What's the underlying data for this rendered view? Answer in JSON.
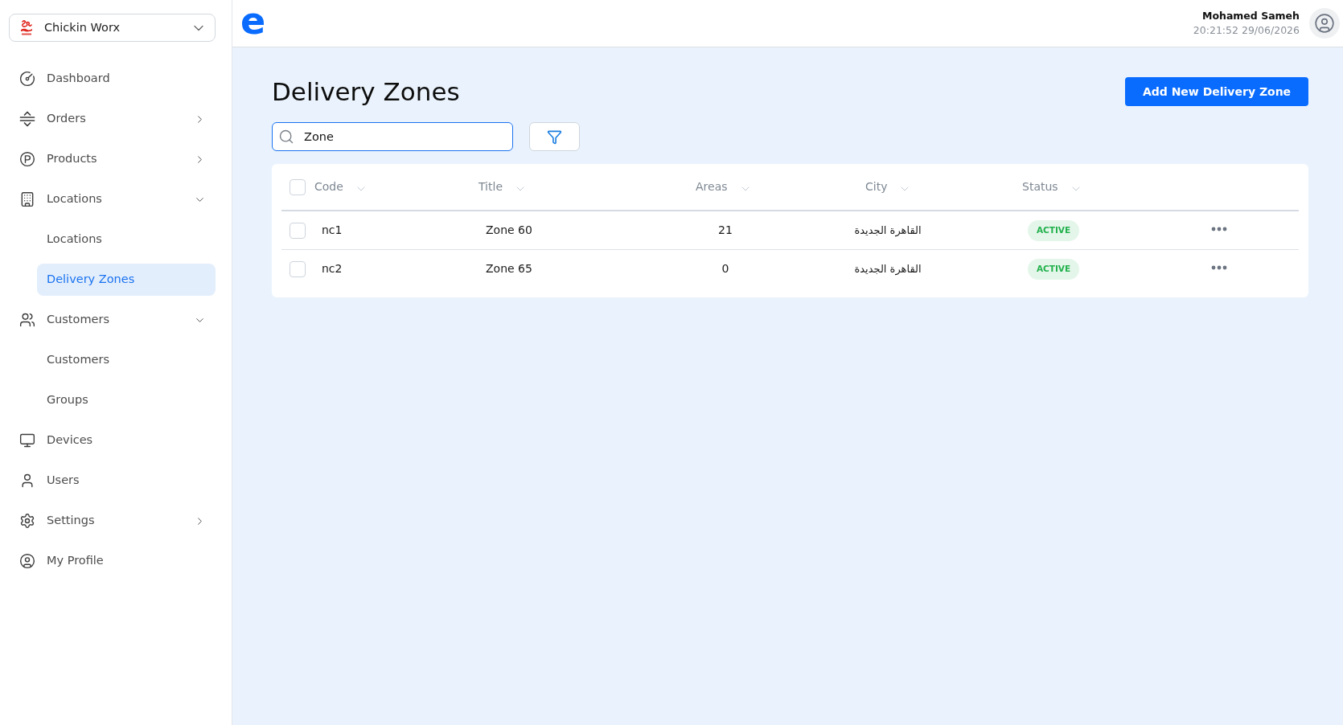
{
  "sidebar": {
    "company_selector": {
      "name": "Chickin Worx"
    },
    "items": [
      {
        "kind": "link",
        "label": "Dashboard",
        "selected": false
      },
      {
        "kind": "group",
        "label": "Orders",
        "selected": false,
        "expanded": false
      },
      {
        "kind": "group",
        "label": "Products",
        "selected": false,
        "expanded": false
      },
      {
        "kind": "group",
        "label": "Locations",
        "selected": false,
        "expanded": true,
        "children": [
          {
            "label": "Locations",
            "selected": false
          },
          {
            "label": "Delivery Zones",
            "selected": true
          }
        ]
      },
      {
        "kind": "group",
        "label": "Customers",
        "selected": false,
        "expanded": true,
        "children": [
          {
            "label": "Customers",
            "selected": false
          },
          {
            "label": "Groups",
            "selected": false
          }
        ]
      },
      {
        "kind": "link",
        "label": "Devices",
        "selected": false
      },
      {
        "kind": "link",
        "label": "Users",
        "selected": false
      },
      {
        "kind": "group",
        "label": "Settings",
        "selected": false,
        "expanded": false
      },
      {
        "kind": "link",
        "label": "My Profile",
        "selected": false
      }
    ]
  },
  "top_bar": {
    "logo": "e",
    "user": {
      "name": "Mohamed Sameh",
      "datetime": "20:21:52 29/06/2026"
    }
  },
  "page": {
    "title": "Delivery Zones",
    "add_button": "Add New Delivery Zone",
    "search": {
      "value": "Zone",
      "focused": true
    }
  },
  "table": {
    "all_checked": false,
    "columns": [
      {
        "label": "Code"
      },
      {
        "label": "Title"
      },
      {
        "label": "Areas"
      },
      {
        "label": "City"
      },
      {
        "label": "Status"
      }
    ],
    "rows": [
      {
        "checked": false,
        "code": "nc1",
        "title": "Zone 60",
        "areas": "21",
        "city": "القاهرة الجديدة",
        "status": "ACTIVE"
      },
      {
        "checked": false,
        "code": "nc2",
        "title": "Zone 65",
        "areas": "0",
        "city": "القاهرة الجديدة",
        "status": "ACTIVE"
      }
    ]
  }
}
